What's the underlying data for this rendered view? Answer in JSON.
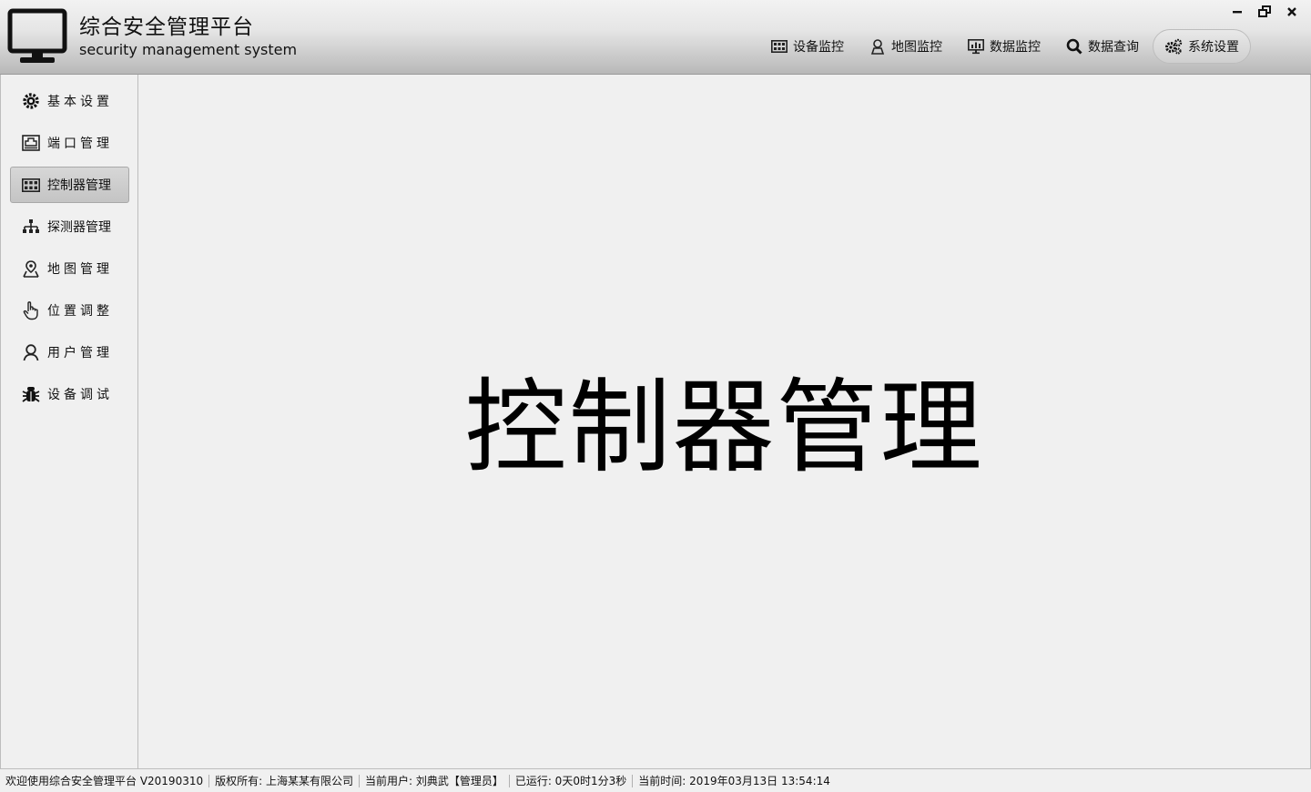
{
  "app": {
    "title": "综合安全管理平台",
    "subtitle": "security management system"
  },
  "window_controls": [
    {
      "name": "minimize-icon"
    },
    {
      "name": "restore-icon"
    },
    {
      "name": "close-icon"
    }
  ],
  "topnav": {
    "items": [
      {
        "label": "设备监控",
        "icon": "grid-icon"
      },
      {
        "label": "地图监控",
        "icon": "map-person-icon"
      },
      {
        "label": "数据监控",
        "icon": "monitor-chart-icon"
      },
      {
        "label": "数据查询",
        "icon": "search-icon"
      },
      {
        "label": "系统设置",
        "icon": "gears-icon",
        "active": true
      }
    ]
  },
  "sidebar": {
    "items": [
      {
        "label": "基本设置",
        "icon": "gear-icon"
      },
      {
        "label": "端口管理",
        "icon": "port-icon"
      },
      {
        "label": "控制器管理",
        "icon": "grid-icon",
        "active": true
      },
      {
        "label": "探测器管理",
        "icon": "sitemap-icon"
      },
      {
        "label": "地图管理",
        "icon": "map-pin-icon"
      },
      {
        "label": "位置调整",
        "icon": "hand-icon"
      },
      {
        "label": "用户管理",
        "icon": "user-icon"
      },
      {
        "label": "设备调试",
        "icon": "bug-icon"
      }
    ]
  },
  "main": {
    "title": "控制器管理"
  },
  "statusbar": {
    "welcome": "欢迎使用综合安全管理平台 V20190310",
    "copyright": "版权所有: 上海某某有限公司",
    "current_user": "当前用户: 刘典武【管理员】",
    "uptime": "已运行: 0天0时1分3秒",
    "current_time": "当前时间: 2019年03月13日 13:54:14"
  },
  "colors": {
    "header_top": "#f2f2f2",
    "header_bottom": "#b8b8b8",
    "background": "#f0f0f0",
    "active_item": "#c4c4c4"
  }
}
